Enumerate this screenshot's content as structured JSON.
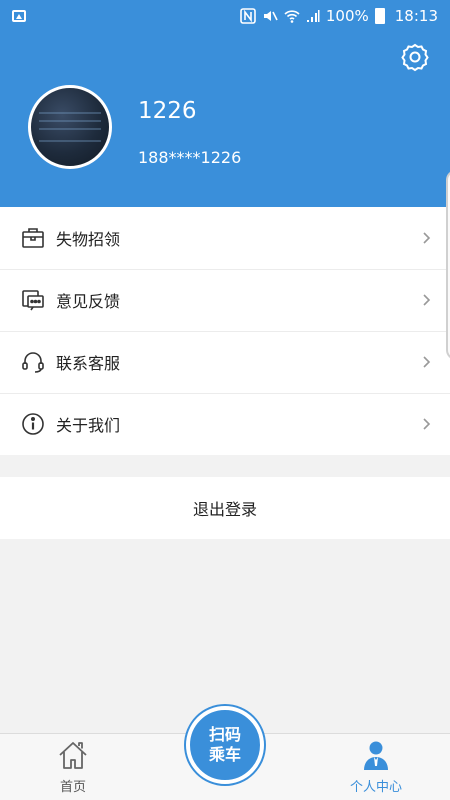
{
  "status_bar": {
    "battery_text": "100%",
    "time": "18:13",
    "icons": [
      "photo-icon",
      "nfc-icon",
      "mute-icon",
      "wifi-icon",
      "signal-icon",
      "battery-icon"
    ]
  },
  "profile": {
    "name": "1226",
    "phone": "188****1226",
    "settings_icon": "gear-icon"
  },
  "menu": [
    {
      "label": "失物招领",
      "icon": "briefcase-icon"
    },
    {
      "label": "意见反馈",
      "icon": "feedback-icon"
    },
    {
      "label": "联系客服",
      "icon": "headset-icon"
    },
    {
      "label": "关于我们",
      "icon": "info-icon"
    }
  ],
  "logout": {
    "label": "退出登录"
  },
  "tabbar": {
    "home_label": "首页",
    "scan_line1": "扫码",
    "scan_line2": "乘车",
    "profile_label": "个人中心"
  },
  "colors": {
    "primary": "#3a8fda",
    "background": "#f2f2f2"
  }
}
